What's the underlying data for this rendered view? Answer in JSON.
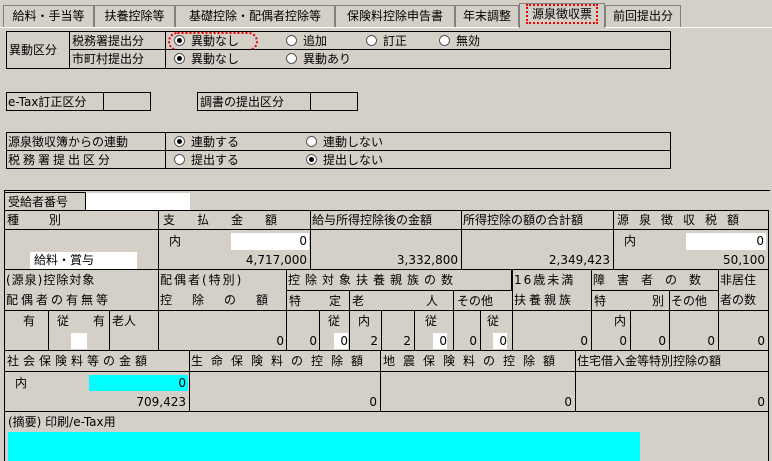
{
  "tabs": [
    "給料・手当等",
    "扶養控除等",
    "基礎控除・配偶者控除等",
    "保険料控除申告書",
    "年末調整",
    "源泉徴収票",
    "前回提出分"
  ],
  "active_tab": "源泉徴収票",
  "ido": {
    "label": "異動区分",
    "zeimusho_label": "税務署提出分",
    "zeimusho_options": [
      "異動なし",
      "追加",
      "訂正",
      "無効"
    ],
    "zeimusho_selected": "異動なし",
    "shichoson_label": "市町村提出分",
    "shichoson_options": [
      "異動なし",
      "異動あり"
    ],
    "shichoson_selected": "異動なし"
  },
  "etax_label": "e-Tax訂正区分",
  "chosho_label": "調書の提出区分",
  "renkei": {
    "label": "源泉徴収簿からの連動",
    "options": [
      "連動する",
      "連動しない"
    ],
    "selected": "連動する"
  },
  "teishutsu": {
    "label": "税務署提出区分",
    "options": [
      "提出する",
      "提出しない"
    ],
    "selected": "提出しない"
  },
  "slip": {
    "recipient_no_label": "受給者番号",
    "recipient_no": "",
    "h_shubetsu": "種別",
    "h_shiharai": "支払金額",
    "h_kyuyo_shotoku": "給与所得控除後の金額",
    "h_shotoku_kojo": "所得控除の額の合計額",
    "h_gensen": "源泉徴収税額",
    "uchi": "内",
    "shubetsu_value": "給料・賞与",
    "shiharai_uchi": "0",
    "shiharai": "4,717,000",
    "kyuyo_shotoku": "3,332,800",
    "shotoku_kojo": "2,349,423",
    "gensen_uchi": "0",
    "gensen": "50,100",
    "h_gensen_kojo_taisho": "(源泉)控除対象",
    "h_haigusha_umu": "配偶者の有無等",
    "h_haigusha_tokubetsu": "配偶者(特別)",
    "h_kojo_gaku": "控除の額",
    "h_fuyo_kazoku": "控除対象扶養親族の数",
    "h_tokutei": "特定",
    "h_rojin": "老人",
    "h_sonota": "その他",
    "h_16sai": "16歳未満",
    "h_16sai_2": "扶養親族",
    "h_shogai": "障害者の数",
    "h_shogai_tokubetsu": "特別",
    "h_shogai_sonota": "その他",
    "h_hikyoju": "非居住",
    "h_hikyoju_2": "者の数",
    "sub_ari": "有",
    "sub_ju": "従",
    "sub_ari2": "有",
    "sub_rojin": "老人",
    "sub_uchi": "内",
    "haigusha_kojo": "0",
    "tokutei": "0",
    "tokutei_ju": "0",
    "rojin_uchi": "2",
    "rojin": "2",
    "rojin_ju": "0",
    "sonota": "0",
    "sonota_ju": "0",
    "sai16": "0",
    "shogai_uchi": "0",
    "shogai_tokubetsu": "0",
    "shogai_sonota": "0",
    "hikyoju": "0",
    "h_shakai_hoken": "社会保険料等の金額",
    "h_seimei": "生命保険料の控除額",
    "h_jishin": "地震保険料の控除額",
    "h_jutaku": "住宅借入金等特別控除の額",
    "shakai_uchi": "0",
    "shakai": "709,423",
    "seimei": "0",
    "jishin": "0",
    "jutaku": "0",
    "tekiyo_label": "(摘要) 印刷/e-Tax用",
    "tekiyo_value": ""
  }
}
